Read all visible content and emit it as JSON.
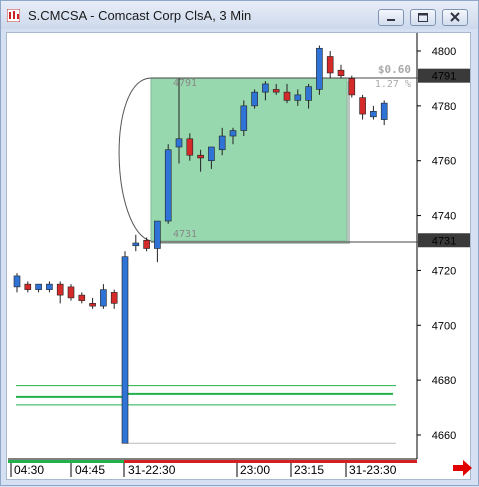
{
  "window": {
    "title": "S.CMCSA - Comcast Corp ClsA, 3 Min",
    "buttons": [
      "minimize",
      "maximize",
      "close"
    ]
  },
  "chart_data": {
    "type": "candlestick",
    "title": "S.CMCSA - Comcast Corp ClsA, 3 Min",
    "y_axis": {
      "ticks": [
        4800,
        4780,
        4760,
        4740,
        4720,
        4700,
        4680,
        4660
      ],
      "range": [
        4656,
        4806
      ]
    },
    "x_axis": {
      "labels": [
        "04:30",
        "04:45",
        "31-22:30",
        "23:00",
        "23:15",
        "31-23:30"
      ]
    },
    "price_flags": [
      {
        "value": 4791,
        "label": "4791"
      },
      {
        "value": 4731,
        "label": "4731"
      }
    ],
    "measurement": {
      "from": 4731,
      "to": 4791,
      "label_high": "4791",
      "label_low": "4731",
      "change": "$0.60",
      "percent": "1.27 %"
    },
    "candles": [
      {
        "o": 4714,
        "h": 4719,
        "l": 4712,
        "c": 4718
      },
      {
        "o": 4715,
        "h": 4716,
        "l": 4712,
        "c": 4713
      },
      {
        "o": 4713,
        "h": 4715,
        "l": 4712,
        "c": 4715
      },
      {
        "o": 4713,
        "h": 4716,
        "l": 4712,
        "c": 4715
      },
      {
        "o": 4715,
        "h": 4716,
        "l": 4708,
        "c": 4711
      },
      {
        "o": 4714,
        "h": 4715,
        "l": 4709,
        "c": 4710
      },
      {
        "o": 4711,
        "h": 4712,
        "l": 4708,
        "c": 4709
      },
      {
        "o": 4708,
        "h": 4710,
        "l": 4706,
        "c": 4707
      },
      {
        "o": 4707,
        "h": 4715,
        "l": 4706,
        "c": 4713
      },
      {
        "o": 4712,
        "h": 4713,
        "l": 4706,
        "c": 4708
      },
      {
        "o": 4657,
        "h": 4727,
        "l": 4657,
        "c": 4725
      },
      {
        "o": 4729,
        "h": 4733,
        "l": 4727,
        "c": 4730
      },
      {
        "o": 4731,
        "h": 4732,
        "l": 4727,
        "c": 4728
      },
      {
        "o": 4728,
        "h": 4733,
        "l": 4723,
        "c": 4738
      },
      {
        "o": 4738,
        "h": 4766,
        "l": 4737,
        "c": 4764
      },
      {
        "o": 4765,
        "h": 4790,
        "l": 4759,
        "c": 4768
      },
      {
        "o": 4768,
        "h": 4770,
        "l": 4760,
        "c": 4762
      },
      {
        "o": 4762,
        "h": 4764,
        "l": 4756,
        "c": 4761
      },
      {
        "o": 4760,
        "h": 4764,
        "l": 4757,
        "c": 4765
      },
      {
        "o": 4764,
        "h": 4772,
        "l": 4762,
        "c": 4769
      },
      {
        "o": 4769,
        "h": 4772,
        "l": 4766,
        "c": 4771
      },
      {
        "o": 4771,
        "h": 4782,
        "l": 4769,
        "c": 4780
      },
      {
        "o": 4780,
        "h": 4786,
        "l": 4779,
        "c": 4785
      },
      {
        "o": 4785,
        "h": 4789,
        "l": 4782,
        "c": 4788
      },
      {
        "o": 4786,
        "h": 4788,
        "l": 4784,
        "c": 4785
      },
      {
        "o": 4785,
        "h": 4788,
        "l": 4781,
        "c": 4782
      },
      {
        "o": 4782,
        "h": 4786,
        "l": 4780,
        "c": 4784
      },
      {
        "o": 4782,
        "h": 4788,
        "l": 4779,
        "c": 4787
      },
      {
        "o": 4786,
        "h": 4802,
        "l": 4784,
        "c": 4801
      },
      {
        "o": 4798,
        "h": 4800,
        "l": 4790,
        "c": 4792
      },
      {
        "o": 4793,
        "h": 4795,
        "l": 4790,
        "c": 4791
      },
      {
        "o": 4790,
        "h": 4791,
        "l": 4783,
        "c": 4784
      },
      {
        "o": 4783,
        "h": 4784,
        "l": 4775,
        "c": 4777
      },
      {
        "o": 4776,
        "h": 4780,
        "l": 4775,
        "c": 4778
      },
      {
        "o": 4775,
        "h": 4782,
        "l": 4773,
        "c": 4781
      }
    ],
    "green_lines": [
      4678,
      4675,
      4671
    ],
    "colors": {
      "up": "#2f73d6",
      "down": "#d42a2a",
      "box": "#7ccb98",
      "green": "#22b14c"
    }
  },
  "footer": {
    "arrow": "scroll-right-arrow"
  }
}
